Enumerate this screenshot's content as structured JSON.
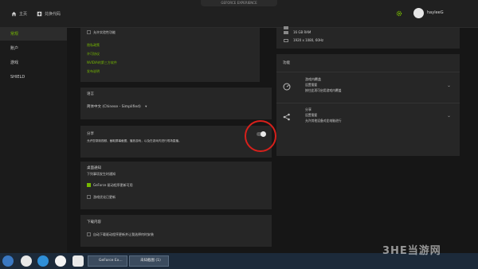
{
  "app": {
    "title": "GEFORCE EXPERIENCE"
  },
  "topbar": {
    "home": "主页",
    "redeem": "兑换代码",
    "username": "hayleeG"
  },
  "sidebar": {
    "items": [
      {
        "label": "常规"
      },
      {
        "label": "账户"
      },
      {
        "label": "游戏"
      },
      {
        "label": "SHIELD"
      }
    ]
  },
  "general": {
    "checkbox_top": "允许实验性功能",
    "links": [
      "隐私政策",
      "许可协议",
      "NVIDIA的第三方软件",
      "发布说明"
    ]
  },
  "language": {
    "title": "语言",
    "value": "简体中文 (Chinese - Simplified)"
  },
  "share": {
    "title": "分享",
    "desc": "允许您录制视频、截取屏幕截图、播放游戏，以及在游戏内进行现场直播。"
  },
  "desktop_notify": {
    "title": "桌面通知",
    "sub": "下列事项发生时通知",
    "items": [
      {
        "label": "GeForce 驱动程序更新可用",
        "checked": true
      },
      {
        "label": "游戏优化已更新",
        "checked": false
      }
    ]
  },
  "download": {
    "title": "下载内容",
    "item": "自动下载驱动程序更新并让我选择何时安装"
  },
  "sysinfo": {
    "lines": [
      "",
      "16 GB RAM",
      "1920 x 1080, 60Hz"
    ]
  },
  "features": {
    "title": "功能",
    "items": [
      {
        "name": "游戏内覆盖",
        "status": "设置需要",
        "desc": "按住此项可启用游戏内覆盖"
      },
      {
        "name": "分享",
        "status": "设置需要",
        "desc": "允许其他设备对此电脑进行"
      }
    ]
  },
  "taskbar": {
    "tasks": [
      "GeForce Ex...",
      "未知截图 (1)"
    ]
  },
  "watermark": "3HE当游网",
  "colors": {
    "accent": "#76b900",
    "highlight_circle": "#d9201b"
  }
}
